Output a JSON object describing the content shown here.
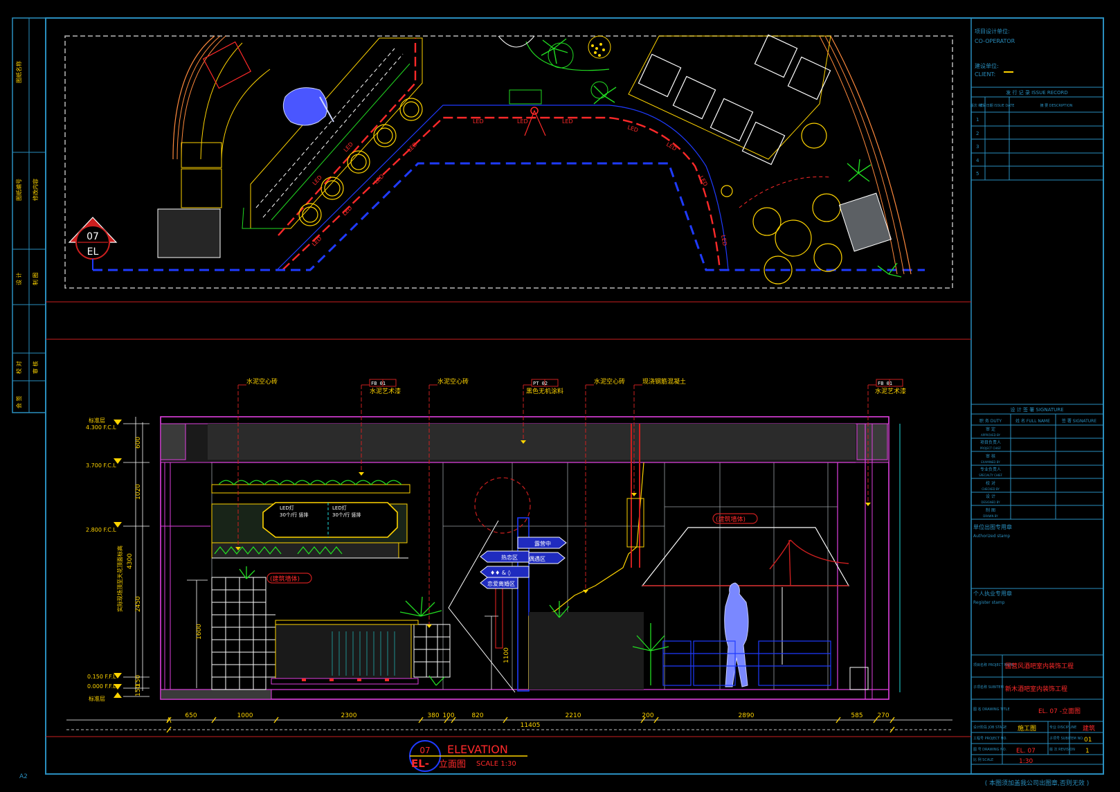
{
  "titleblock": {
    "co_operator_cn": "项目设计单位:",
    "co_operator_en": "CO-OPERATOR",
    "client_cn": "建设单位:",
    "client_en": "CLIENT:",
    "revision_header": "发 行 记 录  ISSUE RECORD",
    "revision_cols": [
      "版次 REV.",
      "发行日期 ISSUE DATE",
      "摘 要 DESCRIPTION"
    ],
    "revision_rows": [
      "1",
      "2",
      "3",
      "4",
      "5"
    ],
    "sign_header": "设 计 签 署  SIGNATURE",
    "sign_cols": [
      "职 务 DUTY",
      "姓 名 FULL NAME",
      "签 署 SIGNATURE"
    ],
    "sign_rows": [
      {
        "cn": "审 定",
        "en": "APPROVED BY"
      },
      {
        "cn": "项目负责人",
        "en": "PROJECT CHIEF"
      },
      {
        "cn": "审 核",
        "en": "EXAMINED BY"
      },
      {
        "cn": "专业负责人",
        "en": "SPECIALTY CHIEF"
      },
      {
        "cn": "校 对",
        "en": "CHECKED BY"
      },
      {
        "cn": "设 计",
        "en": "DESIGNED BY"
      },
      {
        "cn": "制 图",
        "en": "DRAWN BY"
      }
    ],
    "auth_stamp_cn": "单位出图专用章",
    "auth_stamp_en": "Authorized stamp",
    "reg_stamp_cn": "个人执业专用章",
    "reg_stamp_en": "Register stamp",
    "project_label": "项目名称 PROJECT NAME",
    "project_name": "国营风酒吧室内装饰工程",
    "subitem_label": "子项名称 SUBITEM",
    "subitem_name": "新木酒吧室内装饰工程",
    "drawing_title_label": "图 名 DRAWING TITLE",
    "drawing_title": "EL. 07    -立面图",
    "stage_label": "设计阶段 JOB STAGE",
    "stage": "施工图",
    "discipline_label": "专业 DISCIPLINE",
    "discipline": "建筑",
    "project_no_label": "工程号 PROJECT NO.",
    "subitem_no_label": "子项号 SUBITEM NO.",
    "subitem_no": "01",
    "drawing_no_label": "图 号 DRAWING NO.",
    "drawing_no": "EL. 07",
    "revision_label": "版 次 REVISION",
    "revision": "1",
    "scale_label": "比 例 SCALE",
    "scale": "1:30",
    "footnote": "( 本图须加盖我公司出图章,否则无效 )"
  },
  "left_strip": {
    "cells": [
      "图纸名称",
      "图纸编号",
      "修改内容",
      "设 计",
      "制 图",
      "校 对",
      "审 核",
      "会 签"
    ]
  },
  "sheet_size": "A2",
  "plan": {
    "section_mark_no": "07",
    "section_mark_tag": "EL",
    "led_labels": [
      "LED",
      "LED",
      "LED",
      "LED",
      "LED",
      "LED",
      "LED",
      "LED",
      "LED",
      "LED",
      "LED",
      "LED",
      "LED"
    ]
  },
  "elevation": {
    "callouts": [
      {
        "code": "",
        "text": "水泥空心砖"
      },
      {
        "code": "FB  01",
        "text": "水泥艺术漆"
      },
      {
        "code": "",
        "text": "水泥空心砖"
      },
      {
        "code": "PT  02",
        "text": "黑色无机涂料"
      },
      {
        "code": "",
        "text": "水泥空心砖"
      },
      {
        "code": "",
        "text": "现浇钢筋混凝土"
      },
      {
        "code": "FB  01",
        "text": "水泥艺术漆"
      }
    ],
    "level_marks": [
      {
        "label": "标准层",
        "value": "4.300 F.C.L"
      },
      {
        "label": "",
        "value": "3.700 F.C.L"
      },
      {
        "label": "",
        "value": "2.800 F.C.L"
      },
      {
        "label": "",
        "value": "0.150 F.F.L"
      },
      {
        "label": "",
        "value": "0.000 F.F.L"
      },
      {
        "label": "标准层",
        "value": ""
      }
    ],
    "vertical_dims": [
      "600",
      "1020",
      "4300",
      "2450",
      "150",
      "150"
    ],
    "inner_dims": [
      "1600",
      "1100"
    ],
    "vertical_note": "实际现场顶至天花顶面标高",
    "led_panel": [
      "LED灯",
      "30个/行 竖排",
      "LED灯",
      "30个/行 竖排"
    ],
    "sign_arrows": [
      "露营中",
      "热恋区",
      "偶遇区",
      "恋爱离婚区"
    ],
    "sign_left": "♦♦ & ◊",
    "existing_wall": "(建筑墙体)",
    "horizontal_dims": [
      "650",
      "1000",
      "2300",
      "380",
      "100",
      "820",
      "2210",
      "200",
      "2890",
      "585",
      "270"
    ],
    "total_dim": "11405",
    "drawing_title_no": "07",
    "drawing_title_tag": "EL-",
    "drawing_title_en": "ELEVATION",
    "drawing_title_cn": "立面图",
    "drawing_scale": "SCALE  1:30"
  }
}
